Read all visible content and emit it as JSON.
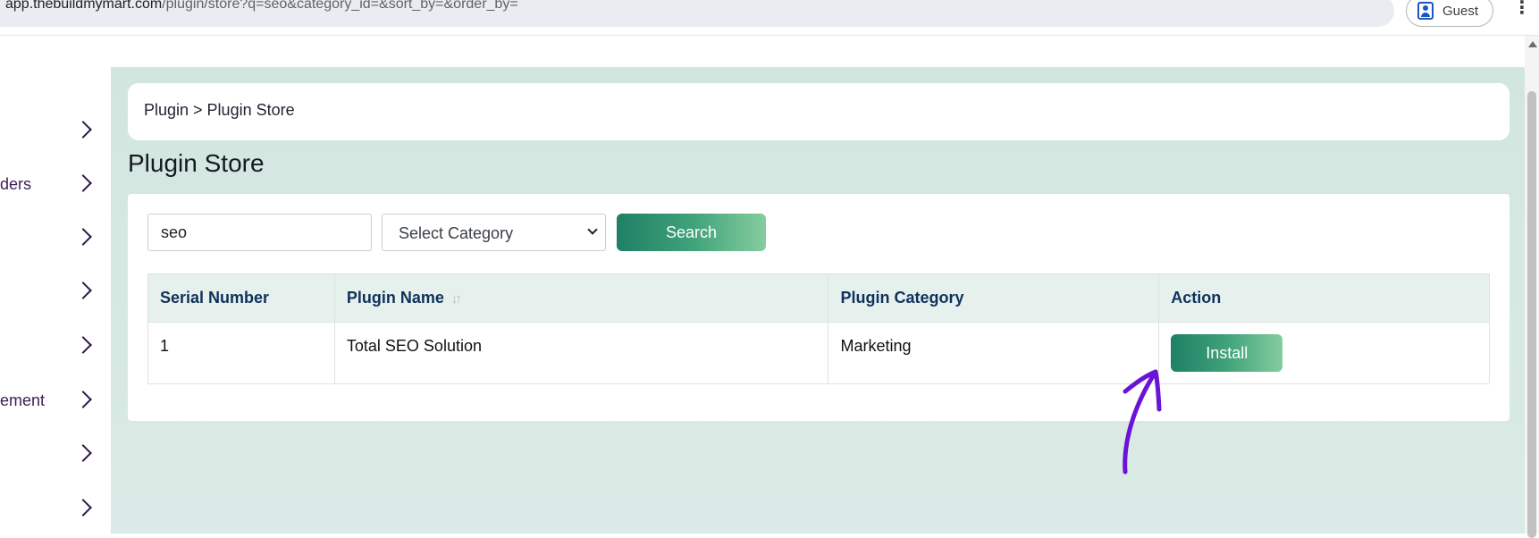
{
  "browser": {
    "url_main": "app.thebuildmymart.com",
    "url_path": "/plugin/store?q=seo&category_id=&sort_by=&order_by=",
    "profile_label": "Guest"
  },
  "sidebar": {
    "items": [
      {
        "label": ""
      },
      {
        "label": "ders"
      },
      {
        "label": ""
      },
      {
        "label": ""
      },
      {
        "label": ""
      },
      {
        "label": "ement"
      },
      {
        "label": ""
      },
      {
        "label": ""
      }
    ]
  },
  "breadcrumb": "Plugin > Plugin Store",
  "page_title": "Plugin Store",
  "search": {
    "value": "seo",
    "category_placeholder": "Select Category",
    "button_label": "Search"
  },
  "table": {
    "headers": [
      "Serial Number",
      "Plugin Name",
      "Plugin Category",
      "Action"
    ],
    "rows": [
      {
        "serial": "1",
        "name": "Total SEO Solution",
        "category": "Marketing",
        "action_label": "Install"
      }
    ]
  },
  "colors": {
    "accent_start": "#1e8065",
    "accent_end": "#86cc9f",
    "annotation": "#6a12d8"
  },
  "icons": [
    "user-profile-icon",
    "more-vert-icon",
    "chevron-right-icon",
    "sort-icon",
    "chevron-down-icon",
    "annotation-arrow-icon"
  ]
}
